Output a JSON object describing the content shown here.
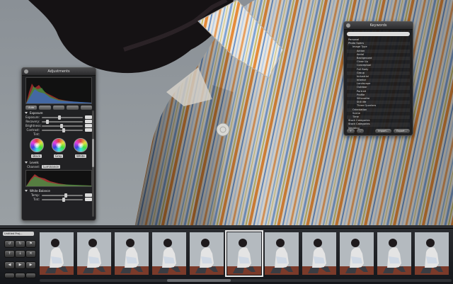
{
  "viewer": {
    "description_tag": "main-image"
  },
  "adjustments": {
    "title": "Adjustments",
    "buttons": [
      "Auto",
      "",
      "",
      "",
      ""
    ],
    "exposure_section": "Exposure",
    "sliders": [
      "Exposure:",
      "Recovery:",
      "Brightness:",
      "Contrast:"
    ],
    "tint_label": "Tint:",
    "wheel_buttons": [
      "Black",
      "Gray",
      "White"
    ],
    "levels_section": "Levels",
    "channel_label": "Channel:",
    "channel_value": "Luminance",
    "white_balance_section": "White Balance",
    "wb_rows": [
      "Temp:",
      "Tint:"
    ]
  },
  "keywords": {
    "title": "Keywords",
    "items": [
      "Personal",
      "Photo Specs",
      "Image Type",
      "Action",
      "Aerial",
      "Background",
      "Close Up",
      "Conceptual",
      "Full Body",
      "Group",
      "Industrial",
      "Interior",
      "Landscape",
      "Outdoor",
      "Portrait",
      "Profile",
      "Silhouette",
      "Still life",
      "Three Quarters",
      "Orientation",
      "Scene",
      "Time",
      "Stock Categories",
      "Stock Categories",
      "Wedding"
    ],
    "footer_left": [
      "+",
      "–"
    ],
    "footer_buttons": [
      "Import...",
      "Export..."
    ]
  },
  "bottom": {
    "project_field": "Untitled Proj...",
    "thumbnail_count": 11,
    "selected_index": 5
  },
  "colors": {
    "hud_bg": "#18181a",
    "browser_bg": "#1c1e22",
    "selection": "#e8e8e8"
  }
}
